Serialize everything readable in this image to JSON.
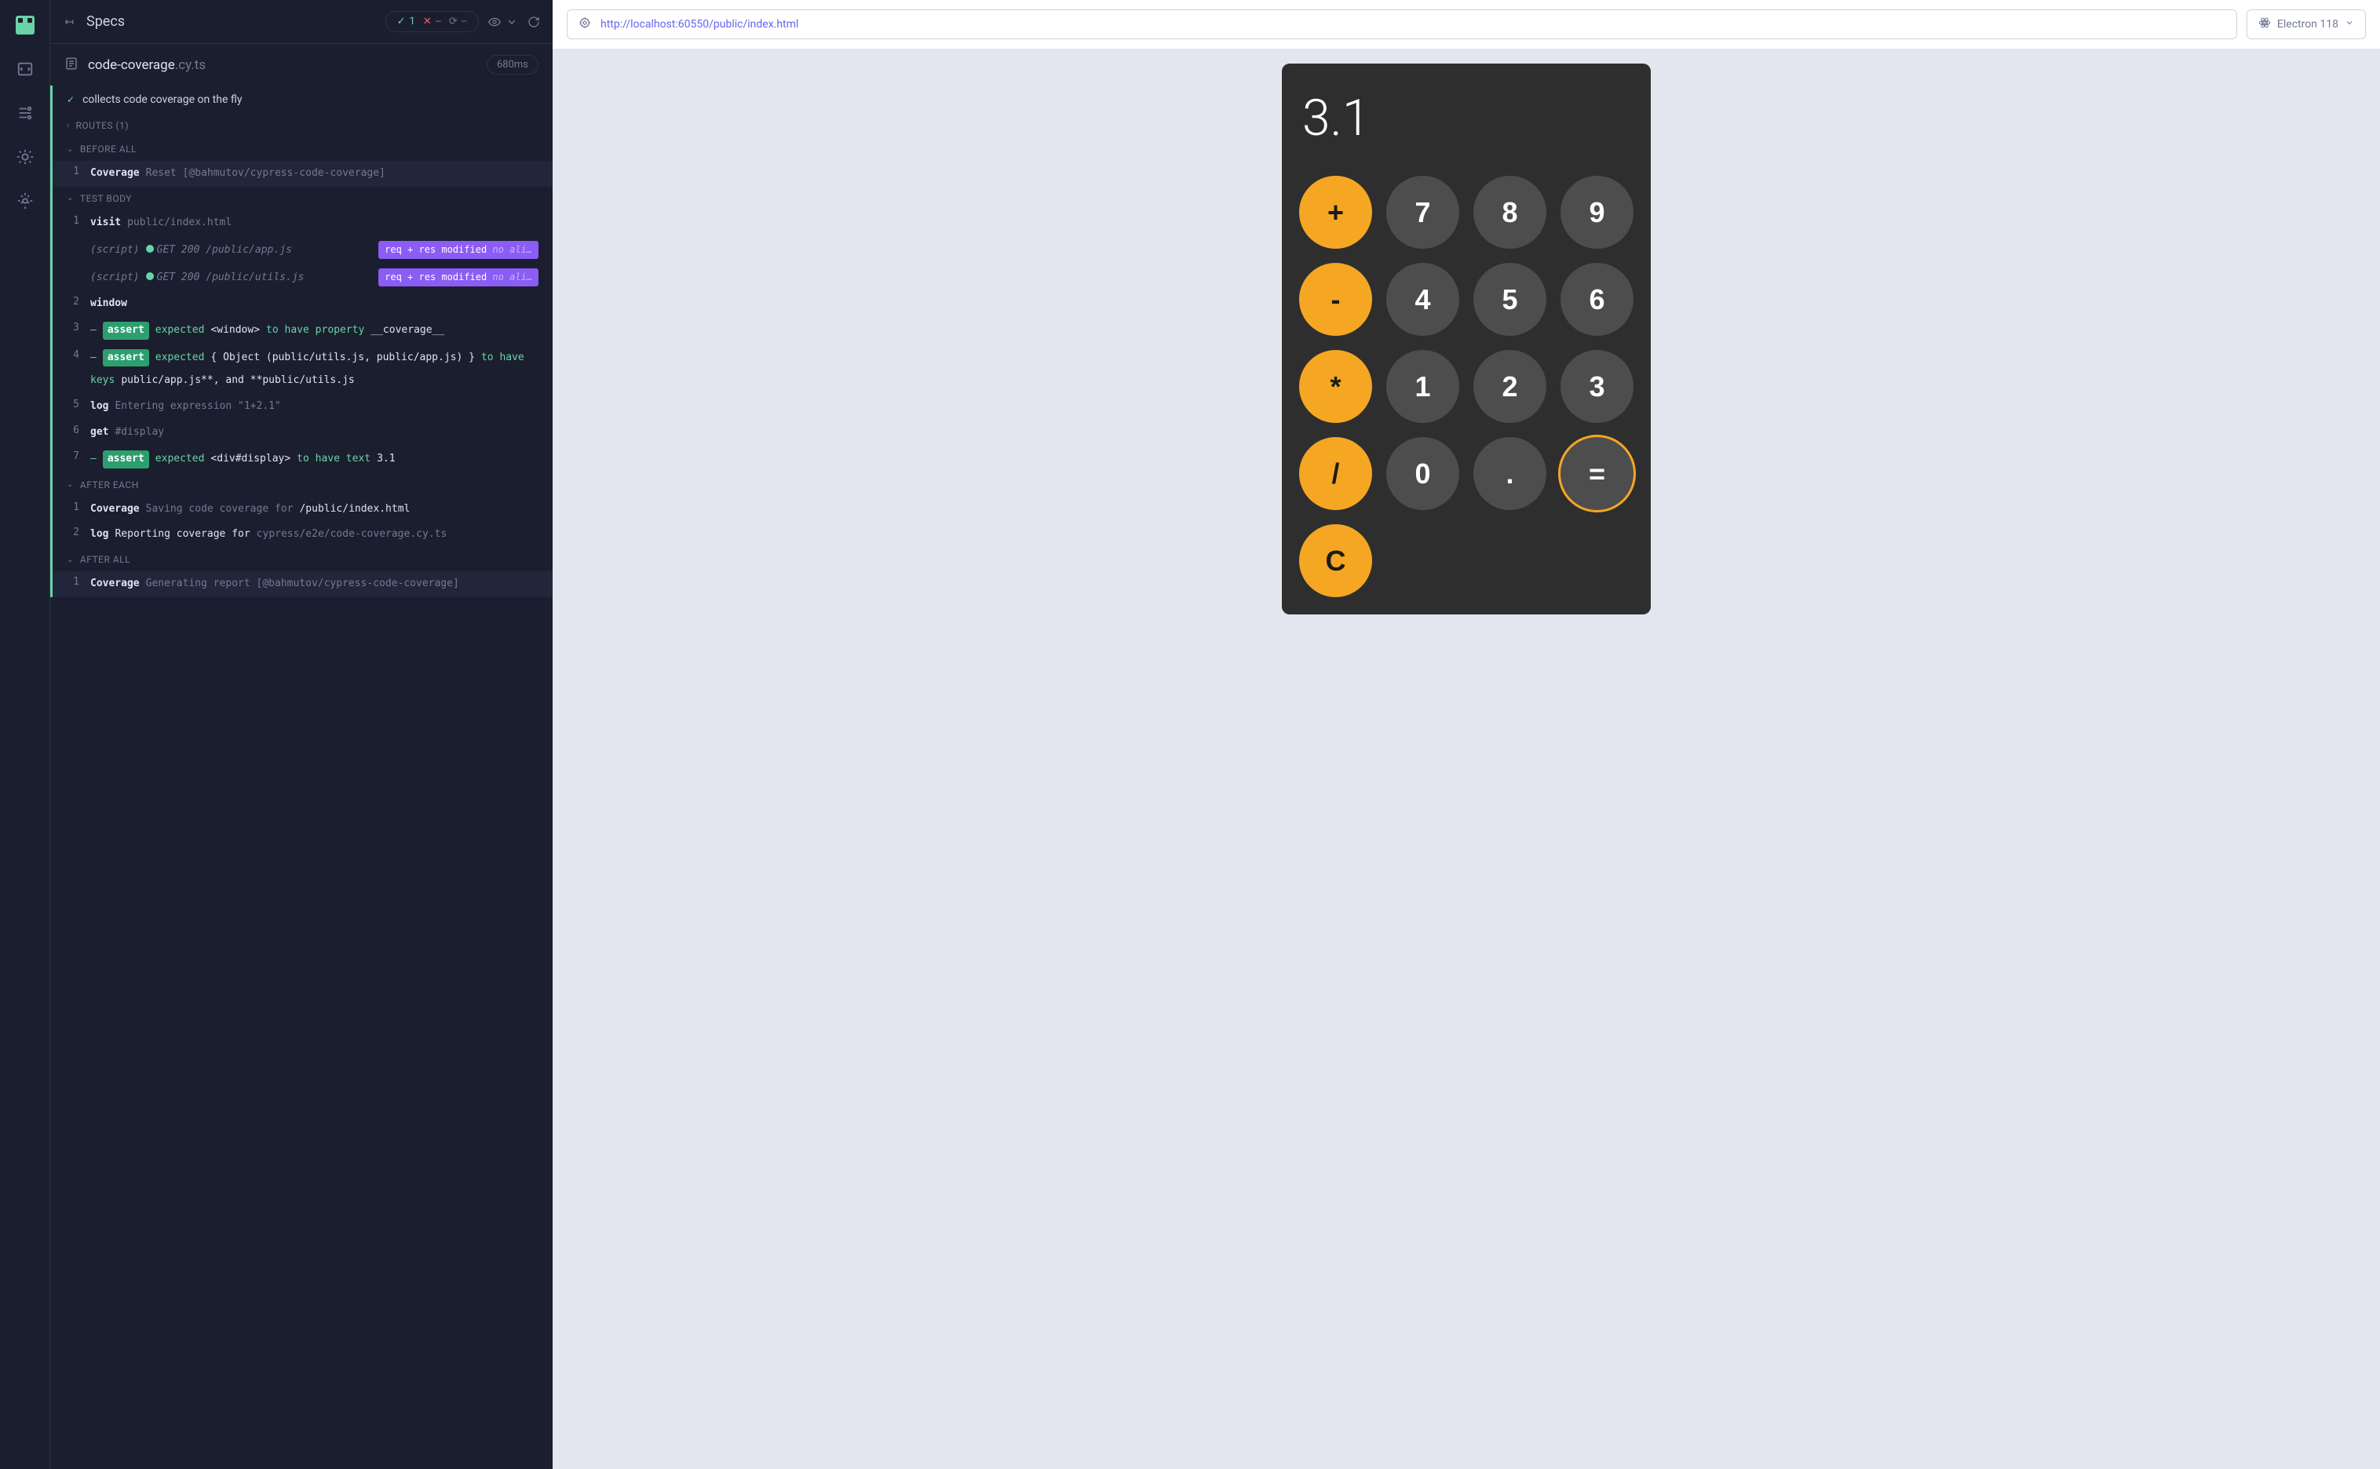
{
  "header": {
    "title": "Specs",
    "stats": {
      "pass": "1",
      "fail": "--",
      "pending": "--"
    }
  },
  "file": {
    "name": "code-coverage",
    "ext": ".cy.ts",
    "duration": "680ms"
  },
  "test": {
    "title": "collects code coverage on the fly",
    "routes_label": "ROUTES (1)",
    "before_all_label": "BEFORE ALL",
    "test_body_label": "TEST BODY",
    "after_each_label": "AFTER EACH",
    "after_all_label": "AFTER ALL"
  },
  "before_all": [
    {
      "num": "1",
      "cmd": "Coverage",
      "arg": "Reset [@bahmutov/cypress-code-coverage]"
    }
  ],
  "body": [
    {
      "num": "1",
      "cmd": "visit",
      "arg": "public/index.html"
    },
    {
      "script": "(script)",
      "status": "GET 200",
      "path": "/public/app.js",
      "badge": "req + res modified",
      "badge_dim": "no ali…"
    },
    {
      "script": "(script)",
      "status": "GET 200",
      "path": "/public/utils.js",
      "badge": "req + res modified",
      "badge_dim": "no ali…"
    },
    {
      "num": "2",
      "cmd": "window",
      "arg": ""
    },
    {
      "num": "3",
      "assert": true,
      "line1_pre": "expected",
      "line1_obj": "<window>",
      "line1_mid": "to have property",
      "line1_post": "__coverage__"
    },
    {
      "num": "4",
      "assert": true,
      "line1_pre": "expected",
      "line1_obj": "{ Object (public/utils.js, public/app.js) }",
      "line1_mid": "to have",
      "line2_pre": "keys",
      "line2_obj": "public/app.js**, and **public/utils.js"
    },
    {
      "num": "5",
      "cmd": "log",
      "arg": "Entering expression \"1+2.1\""
    },
    {
      "num": "6",
      "cmd": "get",
      "arg": "#display"
    },
    {
      "num": "7",
      "assert": true,
      "line1_pre": "expected",
      "line1_obj": "<div#display>",
      "line1_mid": "to have text",
      "line1_post": "3.1"
    }
  ],
  "after_each": [
    {
      "num": "1",
      "cmd": "Coverage",
      "arg_pre": "Saving code coverage for",
      "arg_post": "/public/index.html"
    },
    {
      "num": "2",
      "cmd": "log",
      "arg_pre": "Reporting coverage for",
      "arg_post": "cypress/e2e/code-coverage.cy.ts"
    }
  ],
  "after_all": [
    {
      "num": "1",
      "cmd": "Coverage",
      "arg": "Generating report [@bahmutov/cypress-code-coverage]"
    }
  ],
  "url_bar": {
    "url": "http://localhost:60550/public/index.html",
    "browser": "Electron 118"
  },
  "calculator": {
    "display": "3.1",
    "buttons": [
      {
        "label": "+",
        "type": "op"
      },
      {
        "label": "7",
        "type": "num"
      },
      {
        "label": "8",
        "type": "num"
      },
      {
        "label": "9",
        "type": "num"
      },
      {
        "label": "-",
        "type": "op"
      },
      {
        "label": "4",
        "type": "num"
      },
      {
        "label": "5",
        "type": "num"
      },
      {
        "label": "6",
        "type": "num"
      },
      {
        "label": "*",
        "type": "op"
      },
      {
        "label": "1",
        "type": "num"
      },
      {
        "label": "2",
        "type": "num"
      },
      {
        "label": "3",
        "type": "num"
      },
      {
        "label": "/",
        "type": "op"
      },
      {
        "label": "0",
        "type": "num"
      },
      {
        "label": ".",
        "type": "num"
      },
      {
        "label": "=",
        "type": "eq"
      },
      {
        "label": "C",
        "type": "op"
      }
    ]
  }
}
